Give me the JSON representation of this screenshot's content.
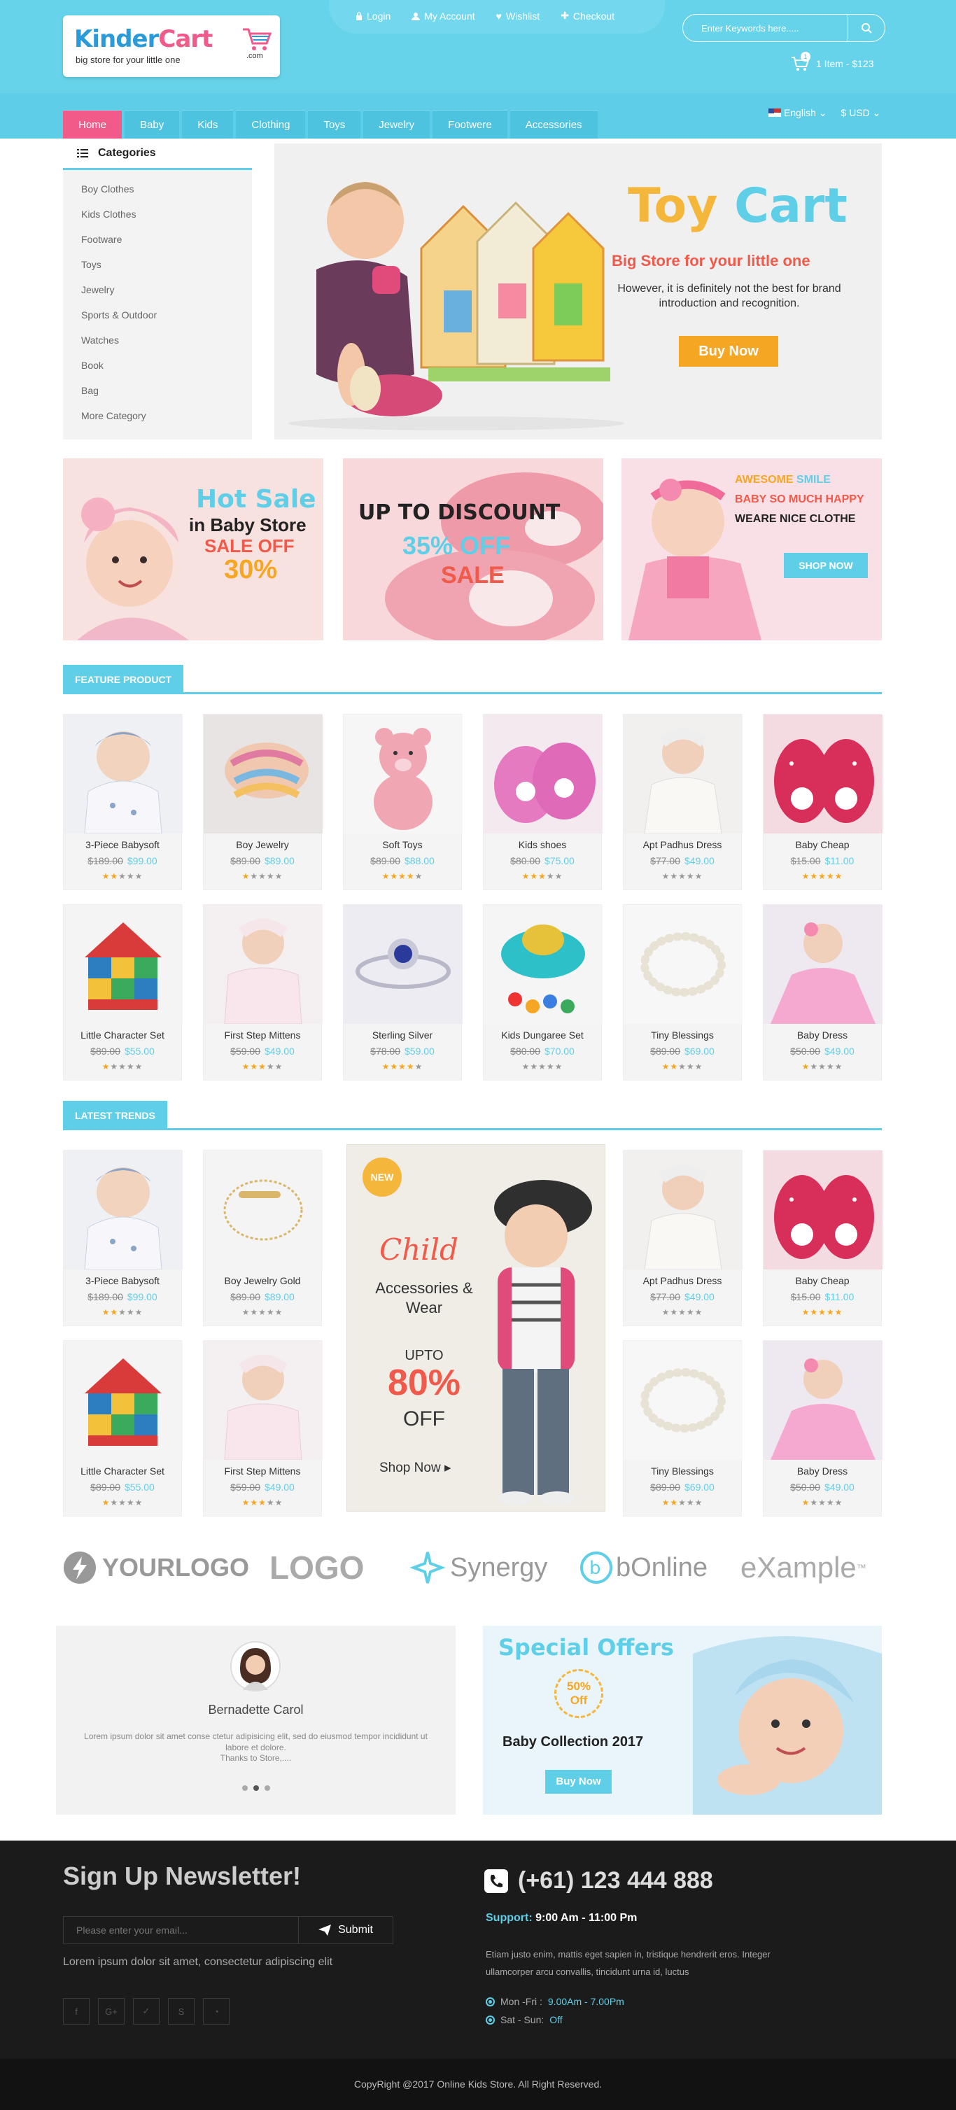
{
  "header": {
    "logo_kinder": "Kinder",
    "logo_cart": "Cart",
    "logo_tagline": "big store for your little one",
    "logo_com": ".com",
    "links": [
      "Login",
      "My Account",
      "Wishlist",
      "Checkout"
    ],
    "search_placeholder": "Enter Keywords here.....",
    "cart_count": "1",
    "cart_summary": "1 Item - $123",
    "language": "English",
    "currency": "$ USD"
  },
  "nav": [
    "Home",
    "Baby",
    "Kids",
    "Clothing",
    "Toys",
    "Jewelry",
    "Footwere",
    "Accessories"
  ],
  "categories": {
    "title": "Categories",
    "items": [
      "Boy Clothes",
      "Kids Clothes",
      "Footware",
      "Toys",
      "Jewelry",
      "Sports & Outdoor",
      "Watches",
      "Book",
      "Bag",
      "More Category"
    ]
  },
  "slider": {
    "title_1": "Toy",
    "title_2": "Cart",
    "subtitle": "Big Store for your little one",
    "description": "However, it is definitely not the best for brand introduction and recognition.",
    "button": "Buy Now"
  },
  "banners": {
    "b1_line1": "Hot Sale",
    "b1_line2": "in Baby Store",
    "b1_line3": "SALE OFF",
    "b1_line4": "30%",
    "b2_line1": "UP TO DISCOUNT",
    "b2_line2": "35% OFF",
    "b2_line3": "SALE",
    "b3_line1a": "AWESOME",
    "b3_line1b": "SMILE",
    "b3_line2": "BABY SO MUCH HAPPY",
    "b3_line3": "WEARE NICE CLOTHE",
    "b3_button": "SHOP NOW"
  },
  "feature": {
    "title": "FEATURE PRODUCT",
    "products": [
      {
        "name": "3-Piece Babysoft",
        "old": "$189.00",
        "new": "$99.00",
        "stars": 2
      },
      {
        "name": "Boy Jewelry",
        "old": "$89.00",
        "new": "$89.00",
        "stars": 1
      },
      {
        "name": "Soft Toys",
        "old": "$89.00",
        "new": "$88.00",
        "stars": 4
      },
      {
        "name": "Kids shoes",
        "old": "$80.00",
        "new": "$75.00",
        "stars": 3
      },
      {
        "name": "Apt Padhus Dress",
        "old": "$77.00",
        "new": "$49.00",
        "stars": 0
      },
      {
        "name": "Baby Cheap",
        "old": "$15.00",
        "new": "$11.00",
        "stars": 5
      },
      {
        "name": "Little Character Set",
        "old": "$89.00",
        "new": "$55.00",
        "stars": 1
      },
      {
        "name": "First Step Mittens",
        "old": "$59.00",
        "new": "$49.00",
        "stars": 3
      },
      {
        "name": "Sterling Silver",
        "old": "$78.00",
        "new": "$59.00",
        "stars": 4
      },
      {
        "name": "Kids Dungaree Set",
        "old": "$80.00",
        "new": "$70.00",
        "stars": 0
      },
      {
        "name": "Tiny Blessings",
        "old": "$89.00",
        "new": "$69.00",
        "stars": 2
      },
      {
        "name": "Baby Dress",
        "old": "$50.00",
        "new": "$49.00",
        "stars": 1
      }
    ]
  },
  "trends": {
    "title": "LATEST TRENDS",
    "products": [
      {
        "name": "3-Piece Babysoft",
        "old": "$189.00",
        "new": "$99.00",
        "stars": 2
      },
      {
        "name": "Boy Jewelry Gold",
        "old": "$89.00",
        "new": "$89.00",
        "stars": 0
      },
      {
        "name": "Apt Padhus Dress",
        "old": "$77.00",
        "new": "$49.00",
        "stars": 0
      },
      {
        "name": "Baby Cheap",
        "old": "$15.00",
        "new": "$11.00",
        "stars": 5
      },
      {
        "name": "Little Character Set",
        "old": "$89.00",
        "new": "$55.00",
        "stars": 1
      },
      {
        "name": "First Step Mittens",
        "old": "$59.00",
        "new": "$49.00",
        "stars": 3
      },
      {
        "name": "Tiny Blessings",
        "old": "$89.00",
        "new": "$69.00",
        "stars": 2
      },
      {
        "name": "Baby Dress",
        "old": "$50.00",
        "new": "$49.00",
        "stars": 1
      }
    ],
    "promo": {
      "badge": "NEW",
      "line1": "Child",
      "line2": "Accessories &",
      "line3": "Wear",
      "upto": "UPTO",
      "percent": "80%",
      "off": "OFF",
      "shop": "Shop Now"
    }
  },
  "brands": {
    "b1": "YOURLOGO",
    "b2": "LOGO",
    "b3": "Synergy",
    "b4": "bOnline",
    "b5": "eXample",
    "b5_tm": "™"
  },
  "testimonial": {
    "name": "Bernadette Carol",
    "text": "Lorem ipsum dolor sit amet conse ctetur adipisicing elit, sed do eiusmod tempor incididunt ut labore et dolore.",
    "thanks": "Thanks to Store,...."
  },
  "special": {
    "title": "Special Offers",
    "badge_line1": "50%",
    "badge_line2": "Off",
    "collection": "Baby Collection 2017",
    "button": "Buy Now"
  },
  "footer": {
    "newsletter_title": "Sign Up Newsletter!",
    "email_placeholder": "Please enter your email...",
    "submit": "Submit",
    "tagline": "Lorem ipsum dolor sit amet, consectetur adipiscing elit",
    "phone": "(+61) 123 444 888",
    "support_label": "Support:",
    "support_hours": "9:00 Am - 11:00 Pm",
    "about": "Etiam justo enim, mattis eget sapien in, tristique hendrerit eros. Integer ullamcorper arcu convallis, tincidunt urna id, luctus",
    "hours_1_label": "Mon -Fri :",
    "hours_1_value": "9.00Am - 7.00Pm",
    "hours_2_label": "Sat - Sun:",
    "hours_2_value": "Off",
    "copyright": "CopyRight @2017 Online Kids Store. All Right Reserved."
  },
  "colors": {
    "accent": "#5fcfe8",
    "pink": "#f15a89",
    "orange": "#f5a623",
    "footer_bg": "#1b1b1b"
  }
}
